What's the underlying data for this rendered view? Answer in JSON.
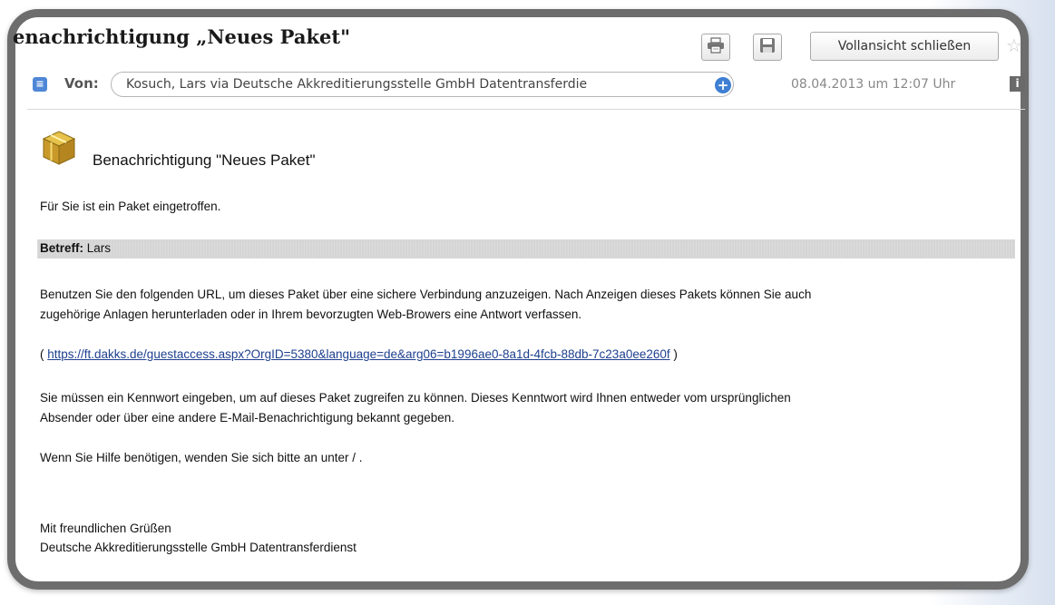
{
  "header": {
    "title": "enachrichtigung „Neues Paket\"",
    "close_label": "Vollansicht schließen"
  },
  "sender": {
    "from_label": "Von:",
    "from_value": "Kosuch, Lars via Deutsche Akkreditierungsstelle GmbH Datentransferdie",
    "date": "08.04.2013 um 12:07 Uhr"
  },
  "message": {
    "heading": "Benachrichtigung \"Neues Paket\"",
    "intro": "Für Sie ist ein Paket eingetroffen.",
    "subject_label": "Betreff:",
    "subject_value": "Lars",
    "url_para_line1": "Benutzen Sie den folgenden URL, um dieses Paket über eine sichere Verbindung anzuzeigen. Nach Anzeigen dieses Pakets können Sie auch",
    "url_para_line2": "zugehörige Anlagen herunterladen oder in Ihrem bevorzugten Web-Browers eine Antwort verfassen.",
    "link_open": "( ",
    "link_url": "https://ft.dakks.de/guestaccess.aspx?OrgID=5380&language=de&arg06=b1996ae0-8a1d-4fcb-88db-7c23a0ee260f",
    "link_close": " )",
    "password_line1": "Sie müssen ein Kennwort eingeben, um auf dieses Paket zugreifen zu können. Dieses Kenntwort wird Ihnen entweder vom ursprünglichen",
    "password_line2": "Absender oder über eine andere E-Mail-Benachrichtigung bekannt gegeben.",
    "help": "Wenn Sie Hilfe benötigen, wenden Sie sich bitte an unter / .",
    "closing": "Mit freundlichen Grüßen",
    "signature": "Deutsche Akkreditierungsstelle GmbH Datentransferdienst"
  },
  "icons": [
    "print-icon",
    "save-icon",
    "star-icon",
    "expand-icon",
    "add-contact-icon",
    "info-icon",
    "package-icon"
  ],
  "colors": {
    "frame": "#6d6d6d",
    "link": "#1d3f8f",
    "accent_blue": "#3f7fd3",
    "subject_bar": "#d5d5d5"
  }
}
